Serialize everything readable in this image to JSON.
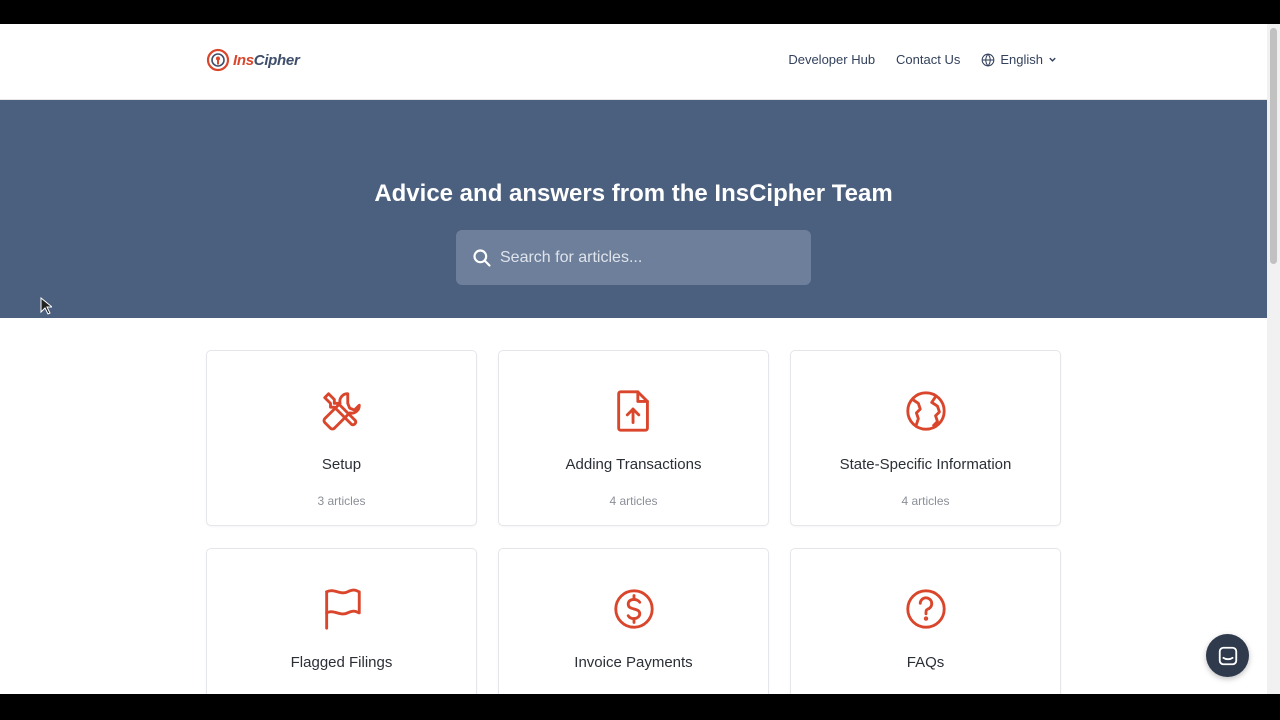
{
  "header": {
    "logo_prefix": "Ins",
    "logo_suffix": "Cipher",
    "nav": {
      "developer_hub": "Developer Hub",
      "contact_us": "Contact Us",
      "language": "English"
    }
  },
  "hero": {
    "title": "Advice and answers from the InsCipher Team",
    "search_placeholder": "Search for articles..."
  },
  "collections": [
    {
      "title": "Setup",
      "count": "3 articles",
      "icon": "tools-icon"
    },
    {
      "title": "Adding Transactions",
      "count": "4 articles",
      "icon": "file-upload-icon"
    },
    {
      "title": "State-Specific Information",
      "count": "4 articles",
      "icon": "globe-icon"
    },
    {
      "title": "Flagged Filings",
      "count": "",
      "icon": "flag-icon"
    },
    {
      "title": "Invoice Payments",
      "count": "",
      "icon": "dollar-icon"
    },
    {
      "title": "FAQs",
      "count": "",
      "icon": "question-icon"
    }
  ],
  "colors": {
    "accent": "#d9462c",
    "hero_bg": "#4b5f7e",
    "chat_bg": "#2f3a4c"
  }
}
